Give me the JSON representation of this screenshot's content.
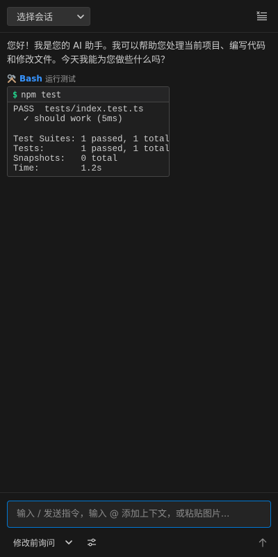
{
  "header": {
    "session_select_label": "选择会话",
    "menu_icon": "list-menu-icon"
  },
  "messages": [
    {
      "role": "assistant",
      "text": "您好！我是您的 AI 助手。我可以帮助您处理当前项目、编写代码和修改文件。今天我能为您做些什么吗？"
    }
  ],
  "tool_call": {
    "icon": "hammer-wrench-icon",
    "name": "Bash",
    "description": "运行测试",
    "prompt": "$",
    "command": "npm test",
    "output": "PASS  tests/index.test.ts\n  ✓ should work (5ms)\n\nTest Suites: 1 passed, 1 total\nTests:       1 passed, 1 total\nSnapshots:   0 total\nTime:        1.2s"
  },
  "composer": {
    "placeholder": "输入 / 发送指令，输入 @ 添加上下文，或粘贴图片...",
    "value": "",
    "mode_label": "修改前询问",
    "settings_icon": "sliders-icon",
    "send_icon": "arrow-up-icon"
  },
  "colors": {
    "background": "#181818",
    "accent": "#0078d4",
    "tool_name": "#3794ff",
    "prompt": "#23d18b"
  }
}
